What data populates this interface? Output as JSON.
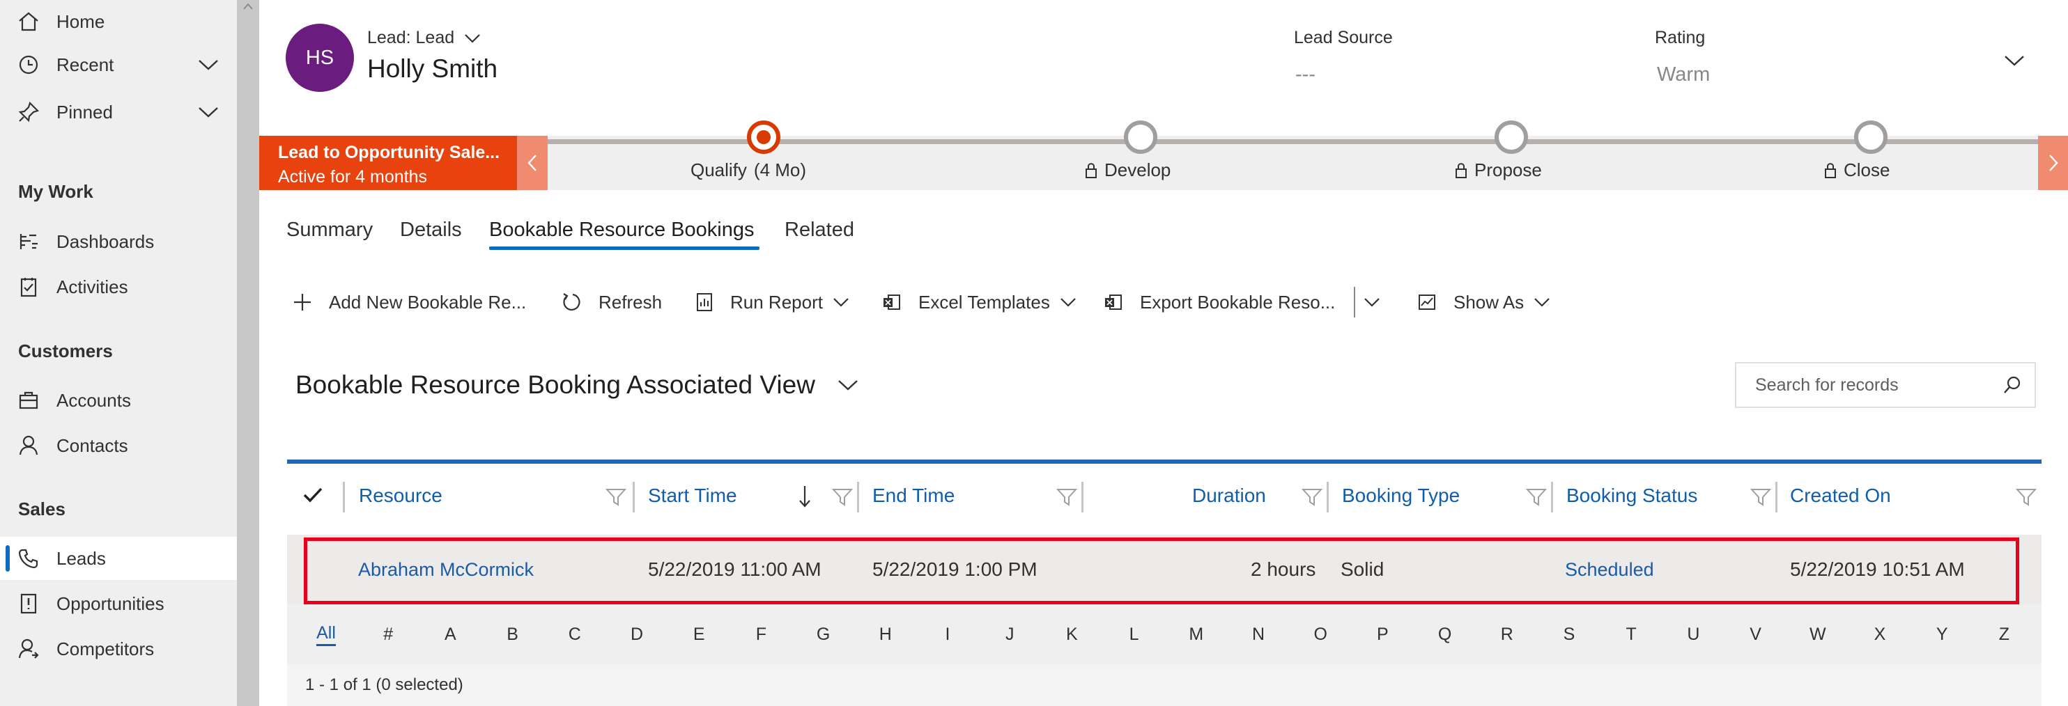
{
  "sidebar": {
    "top_items": [
      {
        "label": "Home",
        "icon": "home-icon"
      },
      {
        "label": "Recent",
        "icon": "clock-icon",
        "expandable": true
      },
      {
        "label": "Pinned",
        "icon": "pin-icon",
        "expandable": true
      }
    ],
    "groups": [
      {
        "title": "My Work",
        "items": [
          {
            "label": "Dashboards",
            "icon": "dashboard-icon"
          },
          {
            "label": "Activities",
            "icon": "activities-icon"
          }
        ]
      },
      {
        "title": "Customers",
        "items": [
          {
            "label": "Accounts",
            "icon": "accounts-icon"
          },
          {
            "label": "Contacts",
            "icon": "contact-icon"
          }
        ]
      },
      {
        "title": "Sales",
        "items": [
          {
            "label": "Leads",
            "icon": "phone-icon",
            "selected": true
          },
          {
            "label": "Opportunities",
            "icon": "opportunity-icon"
          },
          {
            "label": "Competitors",
            "icon": "competitor-icon"
          }
        ]
      }
    ]
  },
  "header": {
    "avatar_initials": "HS",
    "avatar_color": "#6b1d7f",
    "entity_type": "Lead: Lead",
    "record_name": "Holly Smith",
    "fields": [
      {
        "label": "Lead Source",
        "value": "---"
      },
      {
        "label": "Rating",
        "value": "Warm"
      }
    ]
  },
  "process": {
    "name": "Lead to Opportunity Sale...",
    "active_for": "Active for 4 months",
    "accent_color": "#e8420f",
    "stages": [
      {
        "label": "Qualify",
        "duration": "(4 Mo)",
        "active": true,
        "locked": false
      },
      {
        "label": "Develop",
        "active": false,
        "locked": true
      },
      {
        "label": "Propose",
        "active": false,
        "locked": true
      },
      {
        "label": "Close",
        "active": false,
        "locked": true
      }
    ]
  },
  "tabs": [
    {
      "label": "Summary"
    },
    {
      "label": "Details"
    },
    {
      "label": "Bookable Resource Bookings",
      "active": true
    },
    {
      "label": "Related"
    }
  ],
  "commands": {
    "add_new": "Add New Bookable Re...",
    "refresh": "Refresh",
    "run_report": "Run Report",
    "excel_templates": "Excel Templates",
    "export": "Export Bookable Reso...",
    "show_as": "Show As"
  },
  "view": {
    "title": "Bookable Resource Booking Associated View",
    "search_placeholder": "Search for records"
  },
  "grid": {
    "columns": [
      "Resource",
      "Start Time",
      "End Time",
      "Duration",
      "Booking Type",
      "Booking Status",
      "Created On"
    ],
    "sorted_column": "Start Time",
    "sort_direction": "descending",
    "rows": [
      {
        "resource": "Abraham McCormick",
        "start_time": "5/22/2019 11:00 AM",
        "end_time": "5/22/2019 1:00 PM",
        "duration": "2 hours",
        "booking_type": "Solid",
        "booking_status": "Scheduled",
        "created_on": "5/22/2019 10:51 AM"
      }
    ],
    "alphabet": [
      "All",
      "#",
      "A",
      "B",
      "C",
      "D",
      "E",
      "F",
      "G",
      "H",
      "I",
      "J",
      "K",
      "L",
      "M",
      "N",
      "O",
      "P",
      "Q",
      "R",
      "S",
      "T",
      "U",
      "V",
      "W",
      "X",
      "Y",
      "Z"
    ],
    "record_count": "1 - 1 of 1 (0 selected)",
    "highlight_color": "#e8001c"
  }
}
